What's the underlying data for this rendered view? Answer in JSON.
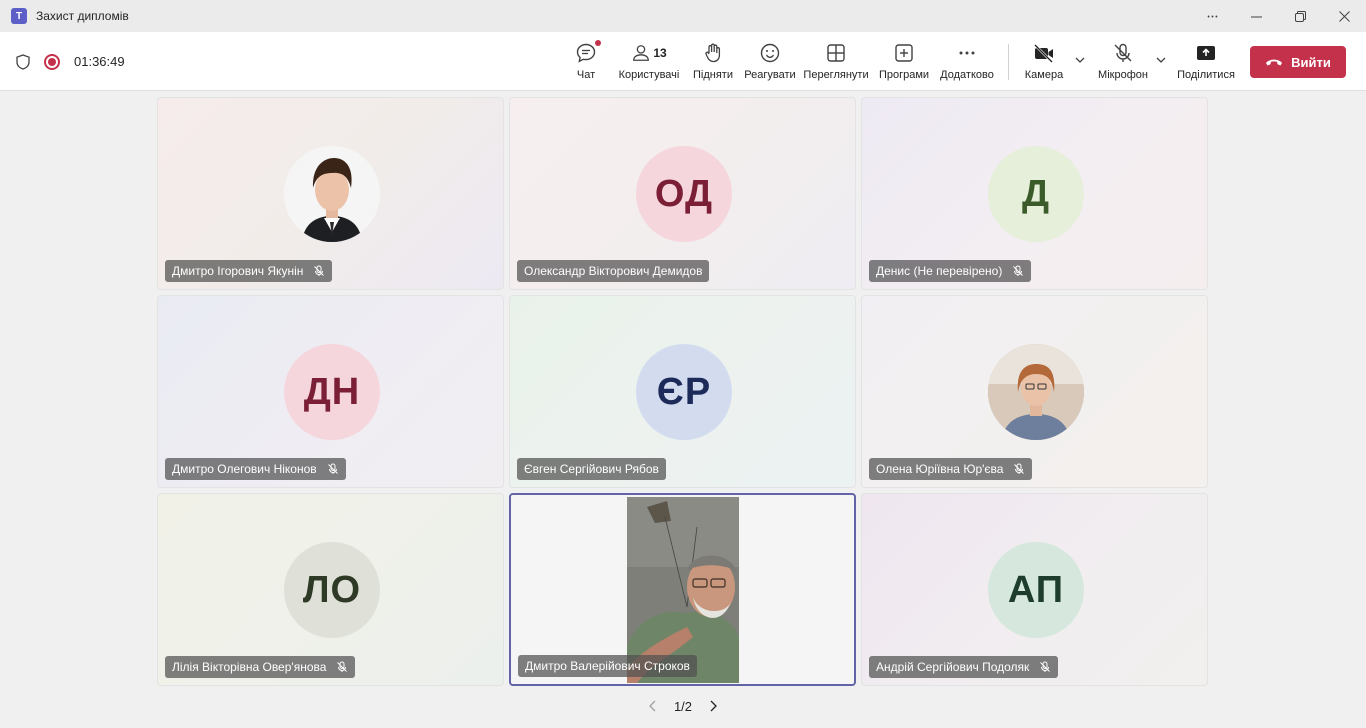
{
  "window": {
    "title": "Захист дипломів",
    "logo_text": "T"
  },
  "status": {
    "timer": "01:36:49"
  },
  "toolbar": {
    "chat_label": "Чат",
    "people_label": "Користувачі",
    "people_count": "13",
    "raise_label": "Підняти",
    "react_label": "Реагувати",
    "view_label": "Переглянути",
    "apps_label": "Програми",
    "more_label": "Додатково",
    "camera_label": "Камера",
    "mic_label": "Мікрофон",
    "share_label": "Поділитися",
    "leave_label": "Вийти"
  },
  "participants": [
    {
      "name": "Дмитро Ігорович Якунін",
      "initials": "",
      "has_photo": true,
      "muted": true,
      "avatar_bg": "#ffffff",
      "avatar_fg": "#242424"
    },
    {
      "name": "Олександр Вікторович Демидов",
      "initials": "ОД",
      "has_photo": false,
      "muted": false,
      "avatar_bg": "#f6d6dd",
      "avatar_fg": "#7a1f35"
    },
    {
      "name": "Денис (Не перевірено)",
      "initials": "Д",
      "has_photo": false,
      "muted": true,
      "avatar_bg": "#e6efda",
      "avatar_fg": "#3b5b2a"
    },
    {
      "name": "Дмитро Олегович Ніконов",
      "initials": "ДН",
      "has_photo": false,
      "muted": true,
      "avatar_bg": "#f6d6dd",
      "avatar_fg": "#7a1f35"
    },
    {
      "name": "Євген Сергійович Рябов",
      "initials": "ЄР",
      "has_photo": false,
      "muted": false,
      "avatar_bg": "#d3dcef",
      "avatar_fg": "#1d2b5a"
    },
    {
      "name": "Олена Юріївна Юр'єва",
      "initials": "",
      "has_photo": true,
      "muted": true,
      "avatar_bg": "#c9b8a8",
      "avatar_fg": "#242424"
    },
    {
      "name": "Лілія Вікторівна Овер'янова",
      "initials": "ЛО",
      "has_photo": false,
      "muted": true,
      "avatar_bg": "#dfe1d9",
      "avatar_fg": "#2f3a26"
    },
    {
      "name": "Дмитро Валерійович Строков",
      "initials": "",
      "has_photo": false,
      "video": true,
      "muted": false,
      "avatar_bg": "#7d7d78",
      "avatar_fg": "#ffffff"
    },
    {
      "name": "Андрій Сергійович Подоляк",
      "initials": "АП",
      "has_photo": false,
      "muted": true,
      "avatar_bg": "#d6e8de",
      "avatar_fg": "#1f3d2c"
    }
  ],
  "pager": {
    "text": "1/2"
  },
  "colors": {
    "accent": "#6264a7",
    "leave": "#c4314b"
  }
}
